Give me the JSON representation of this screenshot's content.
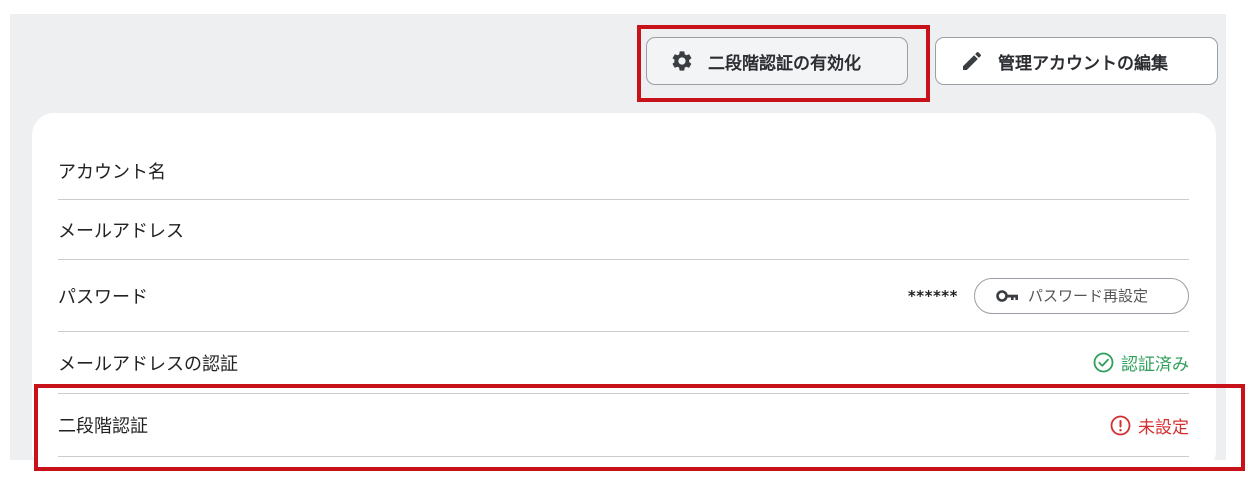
{
  "toolbar": {
    "enable_2fa_label": "二段階認証の有効化",
    "edit_account_label": "管理アカウントの編集"
  },
  "account": {
    "rows": [
      {
        "label": "アカウント名",
        "value": ""
      },
      {
        "label": "メールアドレス",
        "value": ""
      },
      {
        "label": "パスワード",
        "value": "******",
        "action_label": "パスワード再設定"
      },
      {
        "label": "メールアドレスの認証",
        "status": "認証済み"
      },
      {
        "label": "二段階認証",
        "status": "未設定"
      }
    ]
  },
  "colors": {
    "highlight": "#c8121a",
    "status_ok": "#2ea05a",
    "status_ng": "#d32f2f",
    "background": "#eeeff1"
  },
  "icons": {
    "enable_2fa": "gear-icon",
    "edit_account": "pencil-icon",
    "password_reset": "key-icon",
    "email_verified": "check-circle-icon",
    "two_factor_unset": "exclamation-circle-icon"
  }
}
